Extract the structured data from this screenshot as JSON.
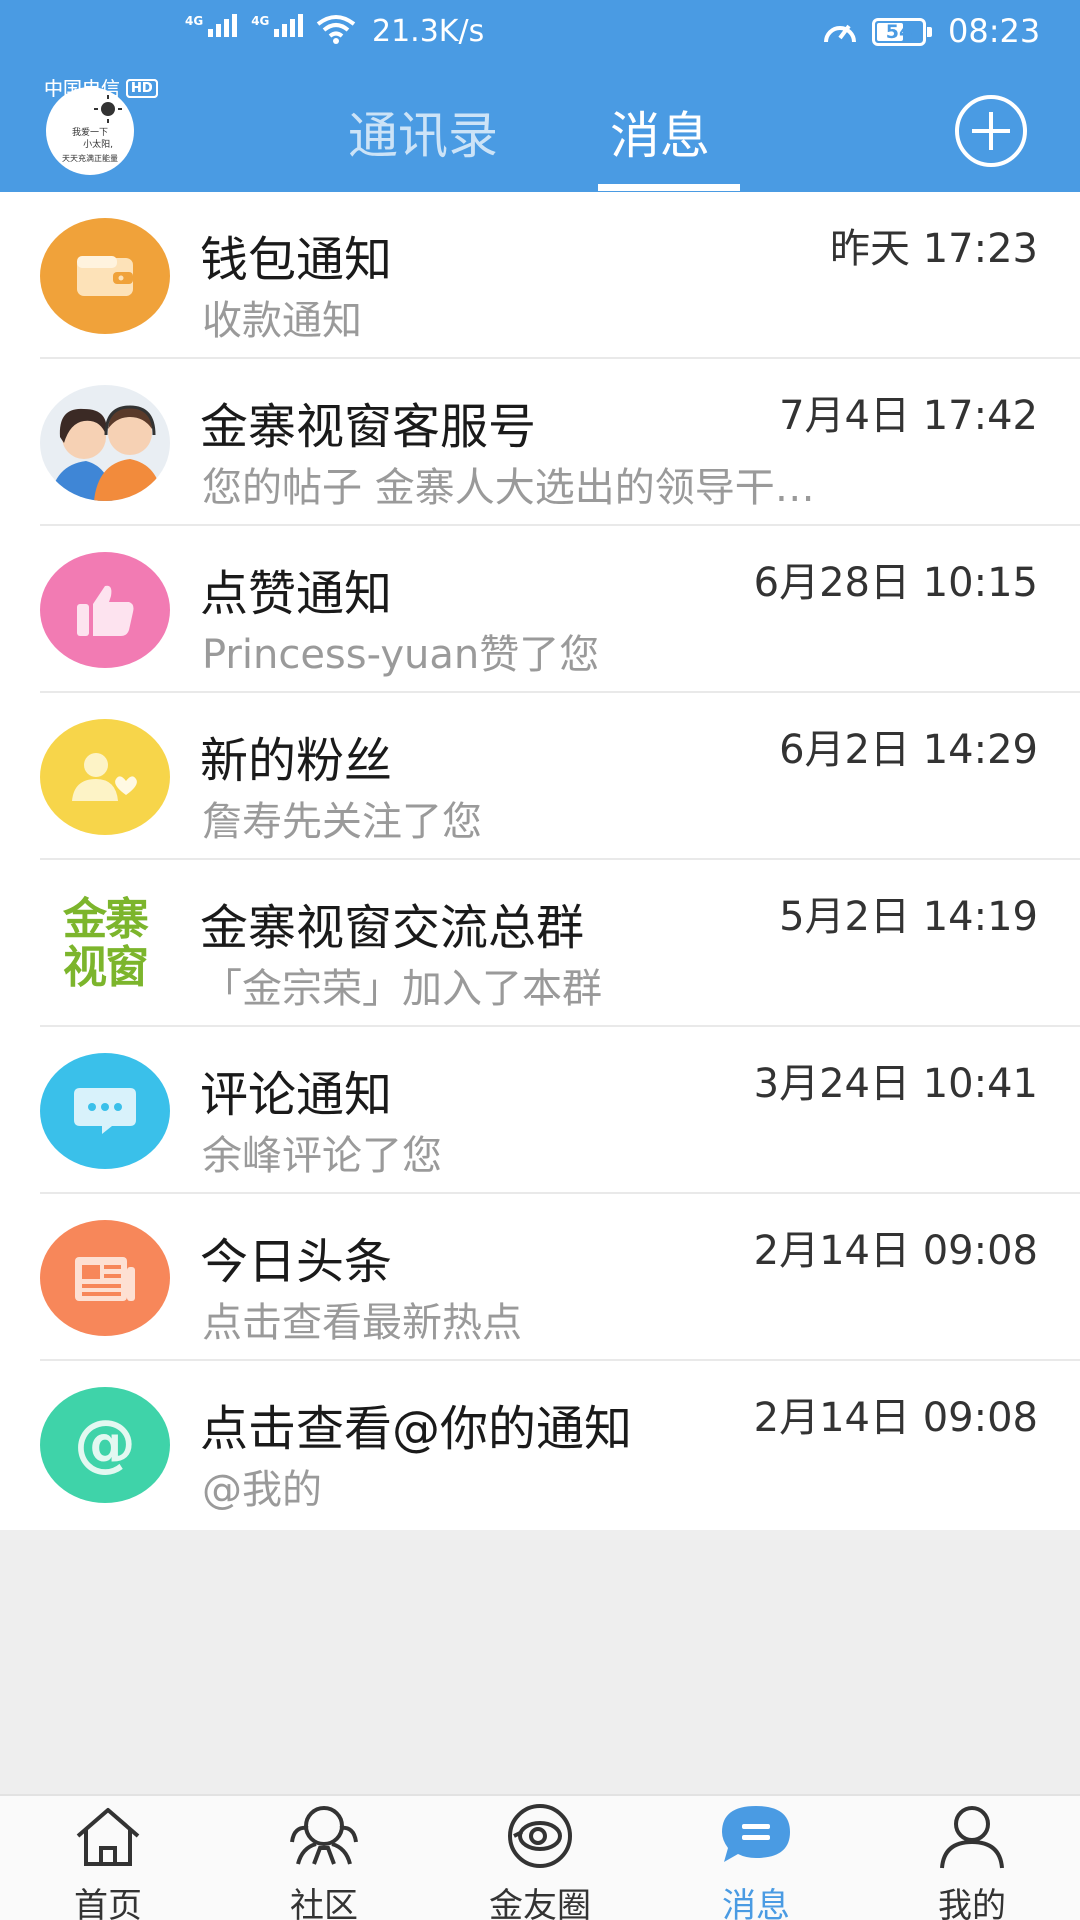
{
  "status_bar": {
    "carrier_1": "中国电信",
    "carrier_2": "中国电信",
    "hd_label": "HD",
    "net_gen_1": "4G",
    "net_gen_2": "4G",
    "net_speed": "21.3K/s",
    "battery": "54",
    "time": "08:23"
  },
  "header": {
    "avatar_text_1": "我爱一下",
    "avatar_text_2": "小太阳,",
    "avatar_text_3": "天天充满正能量",
    "tabs": [
      {
        "label": "通讯录",
        "active": false
      },
      {
        "label": "消息",
        "active": true
      }
    ],
    "accent_color": "#4a9be3"
  },
  "messages": [
    {
      "title": "钱包通知",
      "subtitle": "收款通知",
      "time": "昨天 17:23",
      "icon": "wallet-icon",
      "color": "#f0a23a"
    },
    {
      "title": "金寨视窗客服号",
      "subtitle": "您的帖子 金寨人大选出的领导干…",
      "time": "7月4日 17:42",
      "icon": "customer-service-avatar",
      "color": "#e9eef3"
    },
    {
      "title": "点赞通知",
      "subtitle": "Princess-yuan赞了您",
      "time": "6月28日 10:15",
      "icon": "thumbs-up-icon",
      "color": "#f27bb3"
    },
    {
      "title": "新的粉丝",
      "subtitle": "詹寿先关注了您",
      "time": "6月2日 14:29",
      "icon": "new-fan-icon",
      "color": "#f7d54a"
    },
    {
      "title": "金寨视窗交流总群",
      "subtitle": "「金宗荣」加入了本群",
      "time": "5月2日 14:19",
      "icon": "group-logo",
      "color": "#ffffff"
    },
    {
      "title": "评论通知",
      "subtitle": "余峰评论了您",
      "time": "3月24日 10:41",
      "icon": "comment-icon",
      "color": "#3ac0ea"
    },
    {
      "title": "今日头条",
      "subtitle": "点击查看最新热点",
      "time": "2月14日 09:08",
      "icon": "newspaper-icon",
      "color": "#f7875a"
    },
    {
      "title": "点击查看@你的通知",
      "subtitle": "@我的",
      "time": "2月14日 09:08",
      "icon": "at-icon",
      "color": "#3fd3a9"
    }
  ],
  "group_logo_text": {
    "line1": "金寨",
    "line2": "视窗"
  },
  "tabbar": [
    {
      "label": "首页",
      "icon": "home-icon",
      "active": false
    },
    {
      "label": "社区",
      "icon": "community-icon",
      "active": false
    },
    {
      "label": "金友圈",
      "icon": "friends-circle-icon",
      "active": false
    },
    {
      "label": "消息",
      "icon": "message-icon",
      "active": true
    },
    {
      "label": "我的",
      "icon": "profile-icon",
      "active": false
    }
  ]
}
